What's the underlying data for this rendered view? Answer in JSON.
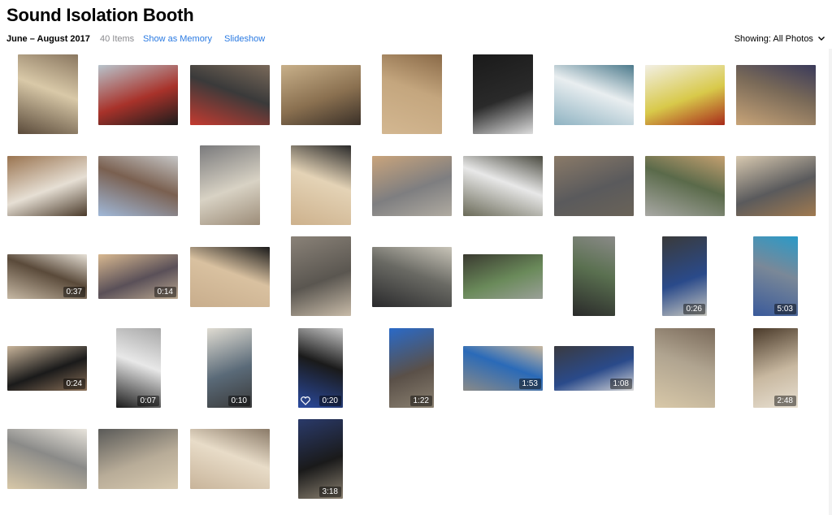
{
  "header": {
    "title": "Sound Isolation Booth",
    "date_range": "June – August 2017",
    "item_count": "40 Items",
    "show_as_memory": "Show as Memory",
    "slideshow": "Slideshow",
    "showing_label": "Showing:",
    "showing_value": "All Photos"
  },
  "grid": {
    "items": [
      {
        "name": "photo-cardboard-panels-hallway",
        "colors": [
          "#5a4a3a",
          "#d9c9a8",
          "#8a7760"
        ]
      },
      {
        "name": "photo-red-convertible-car",
        "colors": [
          "#b8c4cc",
          "#a8322a",
          "#1c1c1c"
        ]
      },
      {
        "name": "photo-car-interior-seat",
        "colors": [
          "#c43a30",
          "#3a3a3a",
          "#7a6a5a"
        ]
      },
      {
        "name": "photo-doorway-room",
        "colors": [
          "#c8b08a",
          "#8a7050",
          "#3a3028"
        ]
      },
      {
        "name": "photo-box-label-weight",
        "colors": [
          "#d3b791",
          "#c4a67e",
          "#8a6a48"
        ]
      },
      {
        "name": "photo-black-glove",
        "colors": [
          "#1a1a1a",
          "#2a2a2a",
          "#dcdcdc"
        ]
      },
      {
        "name": "photo-blue-poster-instructions",
        "colors": [
          "#8fb3c2",
          "#e9eef0",
          "#4c7a8c"
        ]
      },
      {
        "name": "photo-wall-posters",
        "colors": [
          "#f2efe4",
          "#d8c94a",
          "#a82a1a"
        ]
      },
      {
        "name": "photo-booth-room-person",
        "colors": [
          "#c8a478",
          "#7a6a58",
          "#3a3a5a"
        ]
      },
      {
        "name": "photo-booth-corner-floor",
        "colors": [
          "#9a7450",
          "#e6dfd4",
          "#4a3a2a"
        ]
      },
      {
        "name": "photo-clear-tubes",
        "colors": [
          "#a0b8d8",
          "#7a6050",
          "#c6c6c6"
        ]
      },
      {
        "name": "photo-gray-panels-stacked",
        "colors": [
          "#7a7a7c",
          "#d8d2c4",
          "#9c8c78"
        ]
      },
      {
        "name": "photo-clearsonic-box",
        "colors": [
          "#cdb18c",
          "#e4d3b6",
          "#2a2a2a"
        ]
      },
      {
        "name": "photo-gray-panel-in-box",
        "colors": [
          "#c9a47c",
          "#7e7e80",
          "#b0aba1"
        ]
      },
      {
        "name": "photo-manual-sheet",
        "colors": [
          "#6a6a58",
          "#e8e8e8",
          "#4a4a40"
        ]
      },
      {
        "name": "photo-panels-on-carpet",
        "colors": [
          "#8a7a68",
          "#5a5a5c",
          "#6a6358"
        ]
      },
      {
        "name": "photo-ceiling-corner-window",
        "colors": [
          "#a8a8a4",
          "#5a6a4a",
          "#c4a070"
        ]
      },
      {
        "name": "photo-booth-top-lid",
        "colors": [
          "#d8c9b0",
          "#5a5a5c",
          "#a07a50"
        ]
      },
      {
        "name": "photo-booth-wall-video",
        "colors": [
          "#c6b8a4",
          "#5a4a3a",
          "#e6e0d6"
        ],
        "duration": "0:37"
      },
      {
        "name": "photo-person-window-video",
        "colors": [
          "#d8b890",
          "#5a5058",
          "#bba890"
        ],
        "duration": "0:14"
      },
      {
        "name": "photo-clearsonic-label",
        "colors": [
          "#c8ad8c",
          "#d9c1a0",
          "#1a1a1a"
        ]
      },
      {
        "name": "photo-gray-panels-upright",
        "colors": [
          "#8a8278",
          "#5a5650",
          "#c8bba8"
        ]
      },
      {
        "name": "photo-black-couch-window",
        "colors": [
          "#2a2a2c",
          "#6a6a64",
          "#c8c4b8"
        ]
      },
      {
        "name": "photo-window-trees",
        "colors": [
          "#3a3a30",
          "#6a8a5a",
          "#9aa098"
        ]
      },
      {
        "name": "photo-panel-green-light",
        "colors": [
          "#2a2a2a",
          "#5a7050",
          "#8a8a88"
        ]
      },
      {
        "name": "photo-person-window-blue",
        "colors": [
          "#3a3a3a",
          "#2a4a8a",
          "#c8c8c0"
        ],
        "duration": "0:26"
      },
      {
        "name": "photo-meter-on-carpet",
        "colors": [
          "#3a5a9a",
          "#7a8898",
          "#2a9ac8"
        ],
        "duration": "5:03"
      },
      {
        "name": "photo-wall-person-video",
        "colors": [
          "#c8b49a",
          "#1a1a1a",
          "#8a7058"
        ],
        "duration": "0:24"
      },
      {
        "name": "photo-hand-phone-app",
        "colors": [
          "#1a1a1a",
          "#e8e8e8",
          "#a8a8a8"
        ],
        "duration": "0:07"
      },
      {
        "name": "photo-person-booth-door",
        "colors": [
          "#e0dcd2",
          "#5a6a78",
          "#3a3a3a"
        ],
        "duration": "0:10"
      },
      {
        "name": "photo-blue-meter-closeup",
        "colors": [
          "#2a4aa0",
          "#1a1a1a",
          "#c8c8c8"
        ],
        "duration": "0:20",
        "favorite": true
      },
      {
        "name": "photo-person-sitting-floor",
        "colors": [
          "#2a6ac8",
          "#5a5048",
          "#8a8070"
        ],
        "duration": "1:22"
      },
      {
        "name": "photo-person-blue-shirt-booth",
        "colors": [
          "#8a8a88",
          "#2a6ab8",
          "#c8b8a0"
        ],
        "duration": "1:53"
      },
      {
        "name": "photo-meter-blurred",
        "colors": [
          "#3a3a40",
          "#2a4a8a",
          "#d8d8d8"
        ],
        "duration": "1:08"
      },
      {
        "name": "photo-booth-full-view",
        "colors": [
          "#d8c8a8",
          "#b0a490",
          "#7a6a5a"
        ]
      },
      {
        "name": "photo-person-in-booth",
        "colors": [
          "#4a3a2a",
          "#c8b8a0",
          "#e8e0d2"
        ],
        "duration": "2:48"
      },
      {
        "name": "photo-booth-top-corner",
        "colors": [
          "#d8c8a8",
          "#8a8a88",
          "#e8e4dc"
        ]
      },
      {
        "name": "photo-booth-panels-room",
        "colors": [
          "#5a5a58",
          "#b8ac98",
          "#d8cab0"
        ]
      },
      {
        "name": "photo-booth-floor-tiles",
        "colors": [
          "#c8b49a",
          "#e8dcc8",
          "#8a7a68"
        ]
      },
      {
        "name": "photo-meter-hand-video",
        "colors": [
          "#2a3a6a",
          "#1a1a1a",
          "#8a8070"
        ],
        "duration": "3:18"
      }
    ]
  }
}
